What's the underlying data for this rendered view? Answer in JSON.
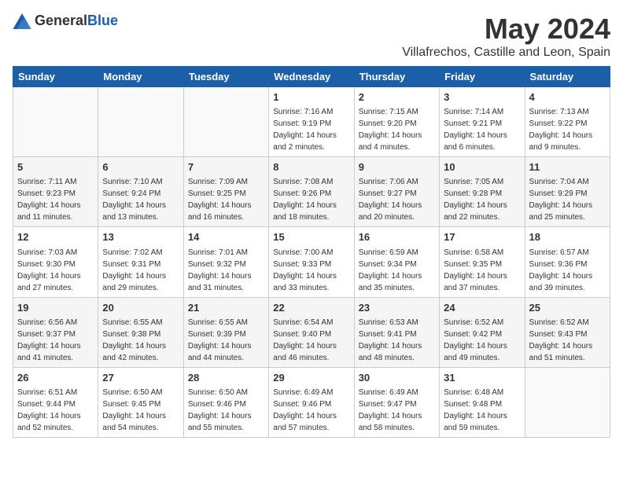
{
  "header": {
    "logo_general": "General",
    "logo_blue": "Blue",
    "month_title": "May 2024",
    "location": "Villafrechos, Castille and Leon, Spain"
  },
  "days_of_week": [
    "Sunday",
    "Monday",
    "Tuesday",
    "Wednesday",
    "Thursday",
    "Friday",
    "Saturday"
  ],
  "weeks": [
    [
      {
        "day": "",
        "sunrise": "",
        "sunset": "",
        "daylight": ""
      },
      {
        "day": "",
        "sunrise": "",
        "sunset": "",
        "daylight": ""
      },
      {
        "day": "",
        "sunrise": "",
        "sunset": "",
        "daylight": ""
      },
      {
        "day": "1",
        "sunrise": "Sunrise: 7:16 AM",
        "sunset": "Sunset: 9:19 PM",
        "daylight": "Daylight: 14 hours and 2 minutes."
      },
      {
        "day": "2",
        "sunrise": "Sunrise: 7:15 AM",
        "sunset": "Sunset: 9:20 PM",
        "daylight": "Daylight: 14 hours and 4 minutes."
      },
      {
        "day": "3",
        "sunrise": "Sunrise: 7:14 AM",
        "sunset": "Sunset: 9:21 PM",
        "daylight": "Daylight: 14 hours and 6 minutes."
      },
      {
        "day": "4",
        "sunrise": "Sunrise: 7:13 AM",
        "sunset": "Sunset: 9:22 PM",
        "daylight": "Daylight: 14 hours and 9 minutes."
      }
    ],
    [
      {
        "day": "5",
        "sunrise": "Sunrise: 7:11 AM",
        "sunset": "Sunset: 9:23 PM",
        "daylight": "Daylight: 14 hours and 11 minutes."
      },
      {
        "day": "6",
        "sunrise": "Sunrise: 7:10 AM",
        "sunset": "Sunset: 9:24 PM",
        "daylight": "Daylight: 14 hours and 13 minutes."
      },
      {
        "day": "7",
        "sunrise": "Sunrise: 7:09 AM",
        "sunset": "Sunset: 9:25 PM",
        "daylight": "Daylight: 14 hours and 16 minutes."
      },
      {
        "day": "8",
        "sunrise": "Sunrise: 7:08 AM",
        "sunset": "Sunset: 9:26 PM",
        "daylight": "Daylight: 14 hours and 18 minutes."
      },
      {
        "day": "9",
        "sunrise": "Sunrise: 7:06 AM",
        "sunset": "Sunset: 9:27 PM",
        "daylight": "Daylight: 14 hours and 20 minutes."
      },
      {
        "day": "10",
        "sunrise": "Sunrise: 7:05 AM",
        "sunset": "Sunset: 9:28 PM",
        "daylight": "Daylight: 14 hours and 22 minutes."
      },
      {
        "day": "11",
        "sunrise": "Sunrise: 7:04 AM",
        "sunset": "Sunset: 9:29 PM",
        "daylight": "Daylight: 14 hours and 25 minutes."
      }
    ],
    [
      {
        "day": "12",
        "sunrise": "Sunrise: 7:03 AM",
        "sunset": "Sunset: 9:30 PM",
        "daylight": "Daylight: 14 hours and 27 minutes."
      },
      {
        "day": "13",
        "sunrise": "Sunrise: 7:02 AM",
        "sunset": "Sunset: 9:31 PM",
        "daylight": "Daylight: 14 hours and 29 minutes."
      },
      {
        "day": "14",
        "sunrise": "Sunrise: 7:01 AM",
        "sunset": "Sunset: 9:32 PM",
        "daylight": "Daylight: 14 hours and 31 minutes."
      },
      {
        "day": "15",
        "sunrise": "Sunrise: 7:00 AM",
        "sunset": "Sunset: 9:33 PM",
        "daylight": "Daylight: 14 hours and 33 minutes."
      },
      {
        "day": "16",
        "sunrise": "Sunrise: 6:59 AM",
        "sunset": "Sunset: 9:34 PM",
        "daylight": "Daylight: 14 hours and 35 minutes."
      },
      {
        "day": "17",
        "sunrise": "Sunrise: 6:58 AM",
        "sunset": "Sunset: 9:35 PM",
        "daylight": "Daylight: 14 hours and 37 minutes."
      },
      {
        "day": "18",
        "sunrise": "Sunrise: 6:57 AM",
        "sunset": "Sunset: 9:36 PM",
        "daylight": "Daylight: 14 hours and 39 minutes."
      }
    ],
    [
      {
        "day": "19",
        "sunrise": "Sunrise: 6:56 AM",
        "sunset": "Sunset: 9:37 PM",
        "daylight": "Daylight: 14 hours and 41 minutes."
      },
      {
        "day": "20",
        "sunrise": "Sunrise: 6:55 AM",
        "sunset": "Sunset: 9:38 PM",
        "daylight": "Daylight: 14 hours and 42 minutes."
      },
      {
        "day": "21",
        "sunrise": "Sunrise: 6:55 AM",
        "sunset": "Sunset: 9:39 PM",
        "daylight": "Daylight: 14 hours and 44 minutes."
      },
      {
        "day": "22",
        "sunrise": "Sunrise: 6:54 AM",
        "sunset": "Sunset: 9:40 PM",
        "daylight": "Daylight: 14 hours and 46 minutes."
      },
      {
        "day": "23",
        "sunrise": "Sunrise: 6:53 AM",
        "sunset": "Sunset: 9:41 PM",
        "daylight": "Daylight: 14 hours and 48 minutes."
      },
      {
        "day": "24",
        "sunrise": "Sunrise: 6:52 AM",
        "sunset": "Sunset: 9:42 PM",
        "daylight": "Daylight: 14 hours and 49 minutes."
      },
      {
        "day": "25",
        "sunrise": "Sunrise: 6:52 AM",
        "sunset": "Sunset: 9:43 PM",
        "daylight": "Daylight: 14 hours and 51 minutes."
      }
    ],
    [
      {
        "day": "26",
        "sunrise": "Sunrise: 6:51 AM",
        "sunset": "Sunset: 9:44 PM",
        "daylight": "Daylight: 14 hours and 52 minutes."
      },
      {
        "day": "27",
        "sunrise": "Sunrise: 6:50 AM",
        "sunset": "Sunset: 9:45 PM",
        "daylight": "Daylight: 14 hours and 54 minutes."
      },
      {
        "day": "28",
        "sunrise": "Sunrise: 6:50 AM",
        "sunset": "Sunset: 9:46 PM",
        "daylight": "Daylight: 14 hours and 55 minutes."
      },
      {
        "day": "29",
        "sunrise": "Sunrise: 6:49 AM",
        "sunset": "Sunset: 9:46 PM",
        "daylight": "Daylight: 14 hours and 57 minutes."
      },
      {
        "day": "30",
        "sunrise": "Sunrise: 6:49 AM",
        "sunset": "Sunset: 9:47 PM",
        "daylight": "Daylight: 14 hours and 58 minutes."
      },
      {
        "day": "31",
        "sunrise": "Sunrise: 6:48 AM",
        "sunset": "Sunset: 9:48 PM",
        "daylight": "Daylight: 14 hours and 59 minutes."
      },
      {
        "day": "",
        "sunrise": "",
        "sunset": "",
        "daylight": ""
      }
    ]
  ]
}
